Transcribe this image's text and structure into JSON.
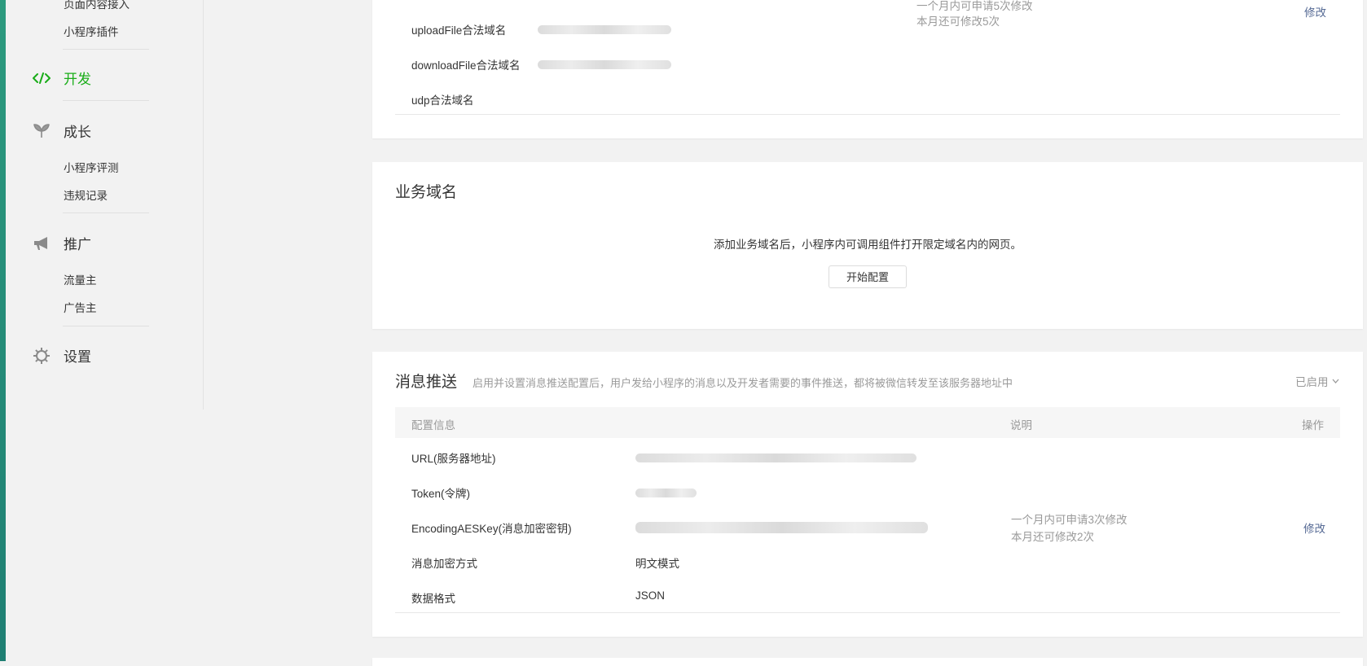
{
  "sidebar": {
    "top_items": [
      "页面内容接入",
      "小程序插件"
    ],
    "sections": [
      {
        "label": "开发",
        "icon": "code-icon",
        "active": true,
        "items": []
      },
      {
        "label": "成长",
        "icon": "sprout-icon",
        "items": [
          "小程序评测",
          "违规记录"
        ]
      },
      {
        "label": "推广",
        "icon": "megaphone-icon",
        "items": [
          "流量主",
          "广告主"
        ]
      },
      {
        "label": "设置",
        "icon": "gear-icon",
        "items": []
      }
    ]
  },
  "server_domains": {
    "rows": [
      "uploadFile合法域名",
      "downloadFile合法域名",
      "udp合法域名"
    ],
    "note_line1": "一个月内可申请5次修改",
    "note_line2": "本月还可修改5次",
    "edit_label": "修改"
  },
  "business_domain": {
    "title": "业务域名",
    "description": "添加业务域名后，小程序内可调用组件打开限定域名内的网页。",
    "button_label": "开始配置"
  },
  "message_push": {
    "title": "消息推送",
    "description": "启用并设置消息推送配置后，用户发给小程序的消息以及开发者需要的事件推送，都将被微信转发至该服务器地址中",
    "status_label": "已启用",
    "columns": {
      "config": "配置信息",
      "note": "说明",
      "action": "操作"
    },
    "rows": [
      {
        "label": "URL(服务器地址)",
        "value": ""
      },
      {
        "label": "Token(令牌)",
        "value": ""
      },
      {
        "label": "EncodingAESKey(消息加密密钥)",
        "value": ""
      },
      {
        "label": "消息加密方式",
        "value": "明文模式"
      },
      {
        "label": "数据格式",
        "value": "JSON"
      }
    ],
    "note_line1": "一个月内可申请3次修改",
    "note_line2": "本月还可修改2次",
    "edit_label": "修改"
  },
  "colors": {
    "accent_green": "#1aad19",
    "link_blue": "#576b95"
  }
}
